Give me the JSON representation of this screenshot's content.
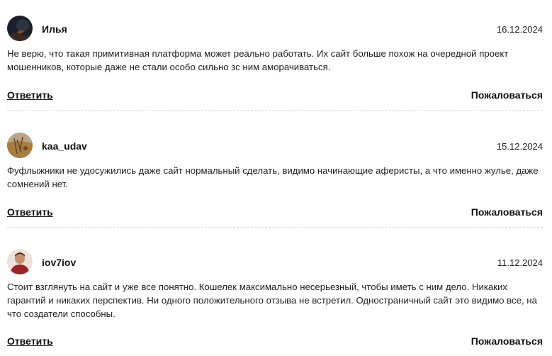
{
  "comments": [
    {
      "author": "Илья",
      "date": "16.12.2024",
      "text": "Не верю, что такая примитивная платформа может реально работать. Их сайт больше похож на очередной проект мошенников, которые даже не стали особо сильно зс ним аморачиваться.",
      "reply_label": "Ответить",
      "report_label": "Пожаловаться",
      "avatar_icon": "user-avatar-dark-photo"
    },
    {
      "author": "kaa_udav",
      "date": "15.12.2024",
      "text": "Фуфлыжники не удосужились даже сайт нормальный сделать, видимо начинающие аферисты, а что именно жулье, даже сомнений нет.",
      "reply_label": "Ответить",
      "report_label": "Пожаловаться",
      "avatar_icon": "user-avatar-landscape-photo"
    },
    {
      "author": "iov7iov",
      "date": "11.12.2024",
      "text": "Стоит взглянуть на сайт и уже все понятно. Кошелек максимально несерьезный, чтобы иметь с ним дело. Никаких гарантий и никаких перспектив. Ни одного положительного отзыва не встретил. Одностраничный сайт это видимо все, на что создатели способны.",
      "reply_label": "Ответить",
      "report_label": "Пожаловаться",
      "avatar_icon": "user-avatar-person-photo"
    }
  ],
  "colors": {
    "text": "#1f1f1f",
    "divider": "#dcdcdc",
    "background": "#ffffff"
  }
}
